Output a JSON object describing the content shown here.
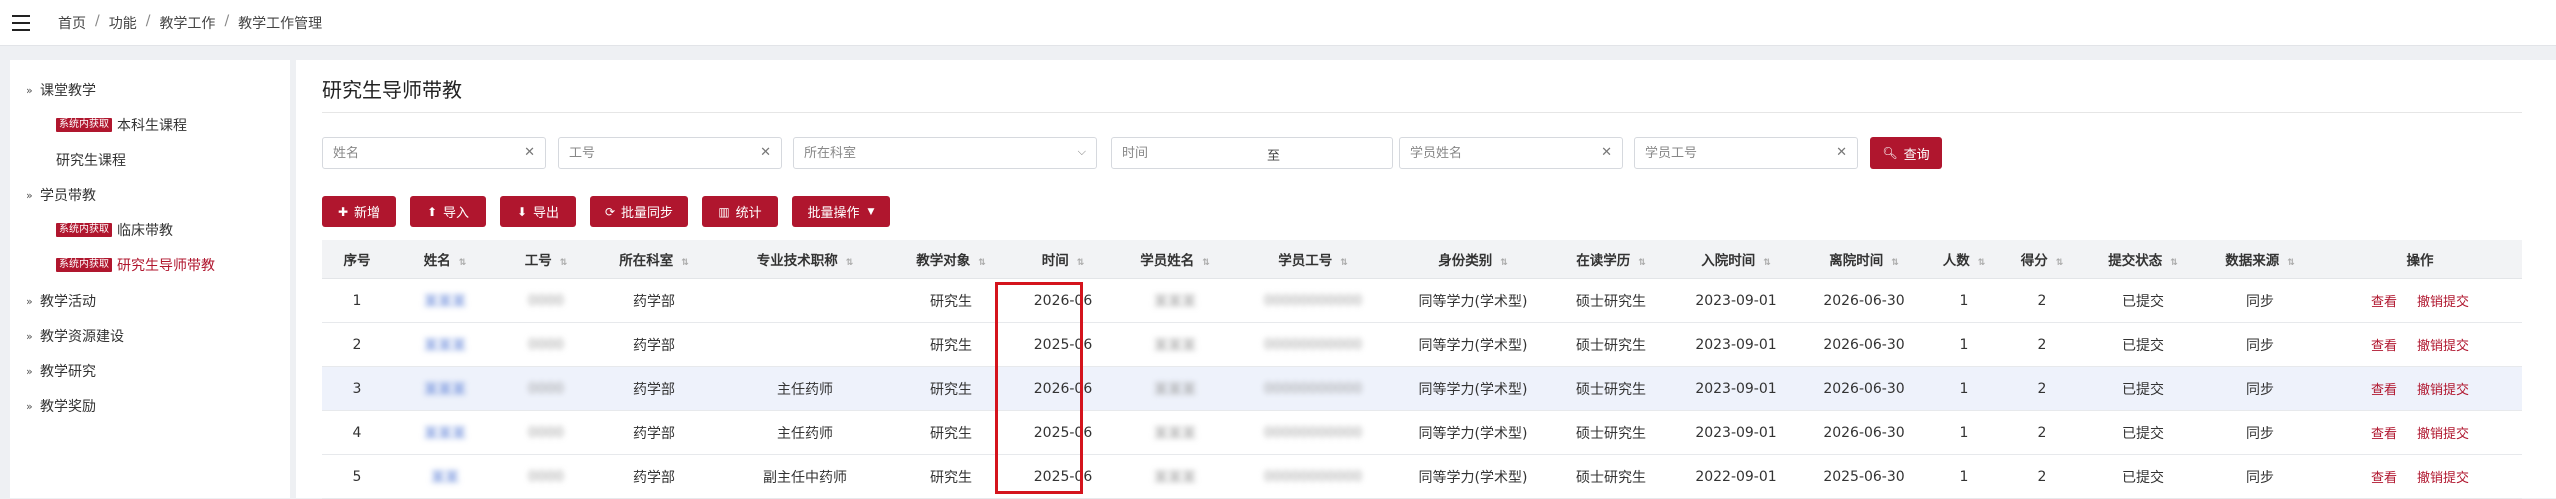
{
  "breadcrumb": [
    "首页",
    "功能",
    "教学工作",
    "教学工作管理"
  ],
  "sidebar": {
    "groups": [
      {
        "label": "课堂教学",
        "expanded": true,
        "items": [
          {
            "tag": "系统内获取",
            "label": "本科生课程",
            "active": false
          },
          {
            "tag": "",
            "label": "研究生课程",
            "active": false
          }
        ]
      },
      {
        "label": "学员带教",
        "expanded": true,
        "items": [
          {
            "tag": "系统内获取",
            "label": "临床带教",
            "active": false
          },
          {
            "tag": "系统内获取",
            "label": "研究生导师带教",
            "active": true
          }
        ]
      },
      {
        "label": "教学活动",
        "expanded": false,
        "items": []
      },
      {
        "label": "教学资源建设",
        "expanded": false,
        "items": []
      },
      {
        "label": "教学研究",
        "expanded": false,
        "items": []
      },
      {
        "label": "教学奖励",
        "expanded": false,
        "items": []
      }
    ]
  },
  "page": {
    "title": "研究生导师带教"
  },
  "filters": {
    "name_placeholder": "姓名",
    "id_placeholder": "工号",
    "dept_placeholder": "所在科室",
    "time_placeholder": "时间",
    "time_to": "至",
    "student_name_placeholder": "学员姓名",
    "student_id_placeholder": "学员工号",
    "search_label": "查询"
  },
  "toolbar": {
    "add": "新增",
    "import": "导入",
    "export": "导出",
    "sync": "批量同步",
    "stats": "统计",
    "batch": "批量操作"
  },
  "table": {
    "headers": [
      "序号",
      "姓名",
      "工号",
      "所在科室",
      "专业技术职称",
      "教学对象",
      "时间",
      "学员姓名",
      "学员工号",
      "身份类别",
      "在读学历",
      "入院时间",
      "离院时间",
      "人数",
      "得分",
      "提交状态",
      "数据来源",
      "操作"
    ],
    "rows": [
      [
        "1",
        "某某某",
        "0000",
        "药学部",
        "",
        "研究生",
        "2026-06",
        "某某某",
        "00000000000",
        "同等学力(学术型)",
        "硕士研究生",
        "2023-09-01",
        "2026-06-30",
        "1",
        "2",
        "已提交",
        "同步"
      ],
      [
        "2",
        "某某某",
        "0000",
        "药学部",
        "",
        "研究生",
        "2025-06",
        "某某某",
        "00000000000",
        "同等学力(学术型)",
        "硕士研究生",
        "2023-09-01",
        "2026-06-30",
        "1",
        "2",
        "已提交",
        "同步"
      ],
      [
        "3",
        "某某某",
        "0000",
        "药学部",
        "主任药师",
        "研究生",
        "2026-06",
        "某某某",
        "00000000000",
        "同等学力(学术型)",
        "硕士研究生",
        "2023-09-01",
        "2026-06-30",
        "1",
        "2",
        "已提交",
        "同步"
      ],
      [
        "4",
        "某某某",
        "0000",
        "药学部",
        "主任药师",
        "研究生",
        "2025-06",
        "某某某",
        "00000000000",
        "同等学力(学术型)",
        "硕士研究生",
        "2023-09-01",
        "2026-06-30",
        "1",
        "2",
        "已提交",
        "同步"
      ],
      [
        "5",
        "某某",
        "0000",
        "药学部",
        "副主任中药师",
        "研究生",
        "2025-06",
        "某某某",
        "00000000000",
        "同等学力(学术型)",
        "硕士研究生",
        "2022-09-01",
        "2025-06-30",
        "1",
        "2",
        "已提交",
        "同步"
      ]
    ],
    "actions": {
      "view": "查看",
      "revoke": "撤销提交"
    }
  },
  "colors": {
    "accent": "#b0162e",
    "highlight_border": "#d4141d"
  }
}
